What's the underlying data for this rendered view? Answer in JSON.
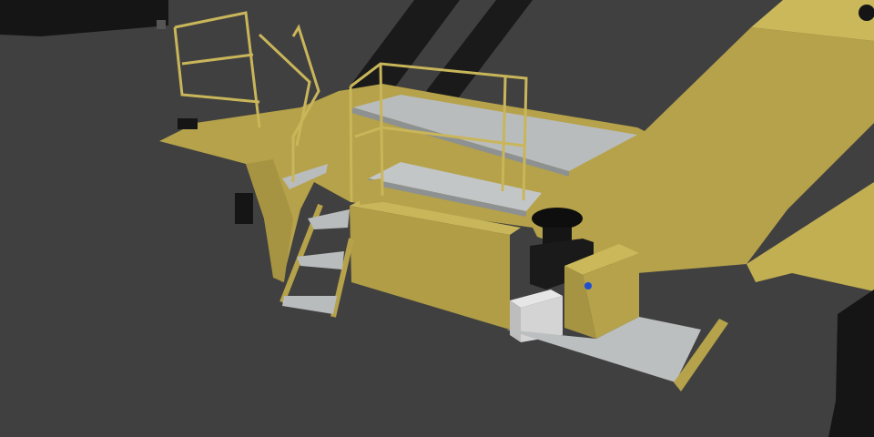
{
  "scene": {
    "subject": "reach-stacker-platform-3d-render",
    "colors": {
      "background": "#404040",
      "body_yellow": "#b5a24a",
      "body_yellow_light": "#cbb85a",
      "body_yellow_dark": "#8f7f35",
      "steel_grey": "#b9bcbc",
      "black_parts": "#151515",
      "white_box": "#d9d9d9",
      "blue_button": "#1f4fd0"
    }
  }
}
